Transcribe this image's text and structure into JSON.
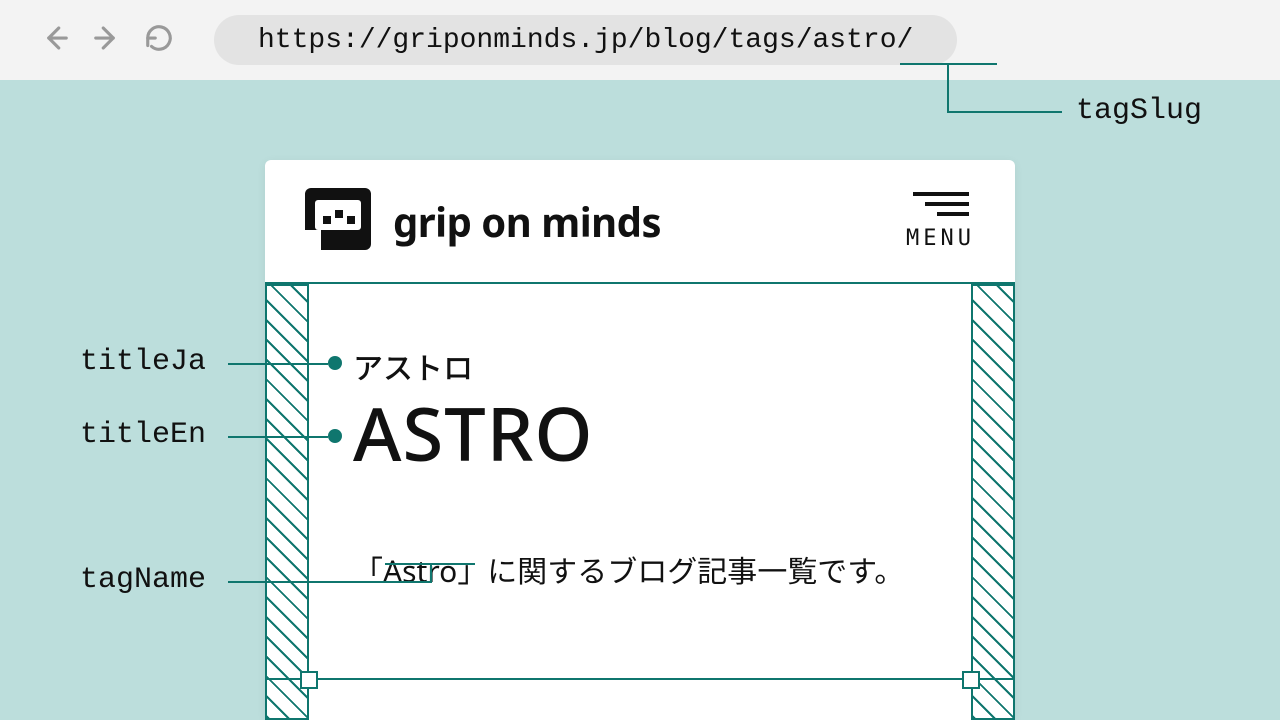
{
  "browser": {
    "url_prefix": "https://griponminds.jp/blog/tags/",
    "url_slug": "astro",
    "url_suffix": "/"
  },
  "callouts": {
    "tagSlug": "tagSlug",
    "titleJa": "titleJa",
    "titleEn": "titleEn",
    "tagName": "tagName"
  },
  "header": {
    "brand": "grip on minds",
    "menu_label": "MENU"
  },
  "page": {
    "title_ja": "アストロ",
    "title_en": "ASTRO",
    "desc_prefix": "「",
    "tag_name": "Astro",
    "desc_suffix": "」に関するブログ記事一覧です。"
  }
}
